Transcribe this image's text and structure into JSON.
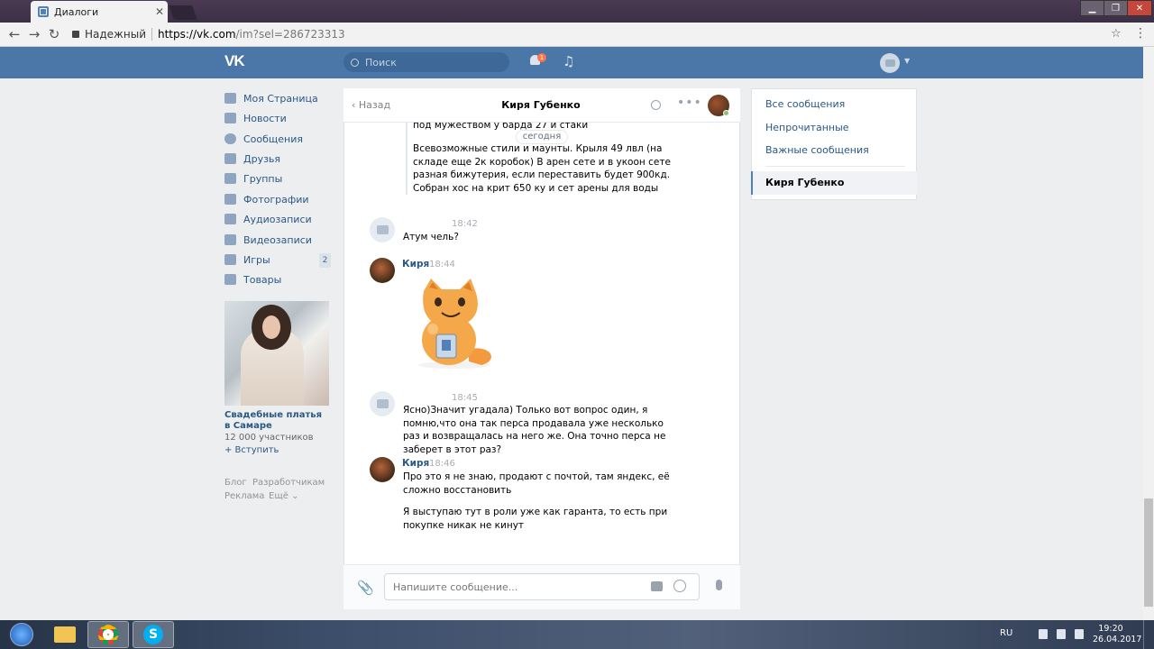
{
  "browser": {
    "tab_title": "Диалоги",
    "tab_close": "✕",
    "secure_label": "Надежный",
    "url_host": "https://vk.com",
    "url_path": "/im?sel=286723313"
  },
  "header": {
    "logo": "VK",
    "search_placeholder": "Поиск",
    "notifications_count": "1"
  },
  "left_menu": {
    "items": [
      {
        "label": "Моя Страница"
      },
      {
        "label": "Новости"
      },
      {
        "label": "Сообщения"
      },
      {
        "label": "Друзья"
      },
      {
        "label": "Группы"
      },
      {
        "label": "Фотографии"
      },
      {
        "label": "Аудиозаписи"
      },
      {
        "label": "Видеозаписи"
      },
      {
        "label": "Игры"
      },
      {
        "label": "Товары"
      }
    ],
    "games_count": "2",
    "ad": {
      "title": "Свадебные платья в Самаре",
      "members": "12 000 участников",
      "join": "+ Вступить"
    },
    "footer": {
      "blog": "Блог",
      "developers": "Разработчикам",
      "ads": "Реклама",
      "more": "Ещё ⌄"
    }
  },
  "chat": {
    "back_label": "Назад",
    "name": "Киря Губенко",
    "date_separator": "сегодня",
    "quote_top": "под мужеством у барда 27 и стаки",
    "quote_text": "Всевозможные стили и мaунты. Крыля 49 лвл (на складе еще 2к коробок) В арен сете и в укоон сете разная бижутерия, если переставить будет 900кд. Собран хос на крит 650 ку и сет арены для воды",
    "messages": [
      {
        "author": "",
        "time": "18:42",
        "text": "Атум чель?"
      },
      {
        "author": "Киря",
        "time": "18:44",
        "text": ""
      },
      {
        "author": "",
        "time": "18:45",
        "text": "Ясно)Значит угадала) Только вот вопрос один, я помню,что она так перса продавала уже несколько раз и возвращалась на него же. Она точно перса не заберет в этот раз?"
      },
      {
        "author": "Киря",
        "time": "18:46",
        "text": "Про это я не знаю, продают с почтой, там яндекс, её сложно восстановить",
        "text2": "Я выступаю тут в роли уже как гаранта, то есть при покупке никак не кинут"
      }
    ],
    "input_placeholder": "Напишите сообщение..."
  },
  "right_panel": {
    "items": [
      {
        "label": "Все сообщения"
      },
      {
        "label": "Непрочитанные"
      },
      {
        "label": "Важные сообщения"
      }
    ],
    "active": "Киря Губенко"
  },
  "taskbar": {
    "lang": "RU",
    "time": "19:20",
    "date": "26.04.2017"
  }
}
